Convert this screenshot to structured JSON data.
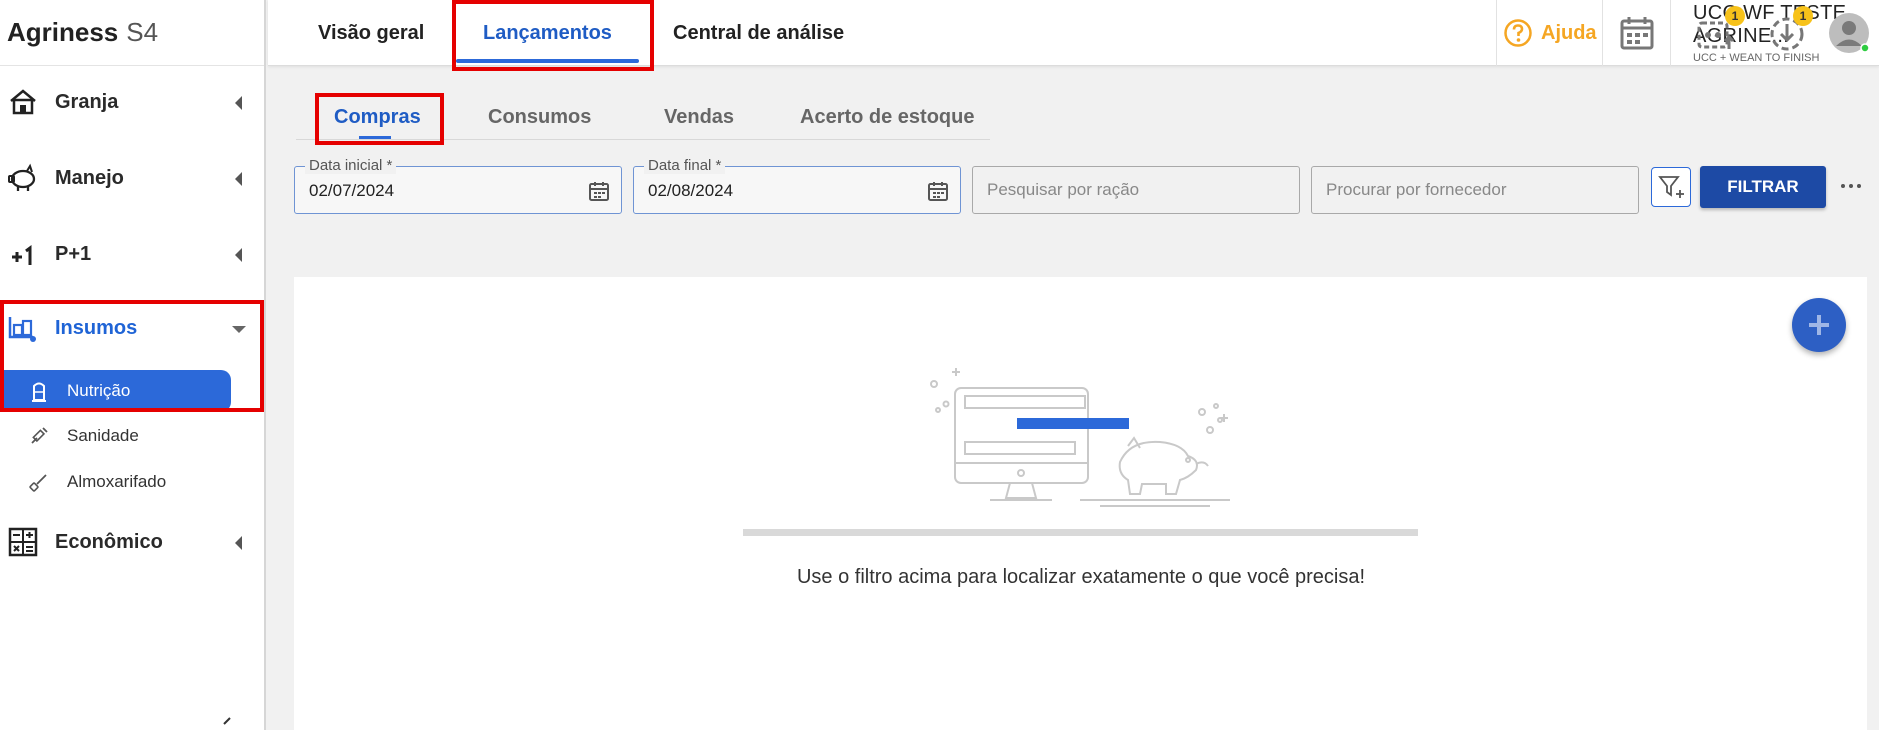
{
  "brand": {
    "name": "Agriness",
    "version": "S4"
  },
  "sidebar": {
    "items": [
      {
        "label": "Granja",
        "icon": "house-icon"
      },
      {
        "label": "Manejo",
        "icon": "pig-icon"
      },
      {
        "label": "P+1",
        "icon": "plus-one-icon"
      },
      {
        "label": "Insumos",
        "icon": "supplies-cart-icon",
        "expanded": true
      },
      {
        "label": "Econômico",
        "icon": "calculator-icon"
      }
    ],
    "subitems": [
      {
        "label": "Nutrição",
        "icon": "silo-icon",
        "active": true
      },
      {
        "label": "Sanidade",
        "icon": "syringe-icon"
      },
      {
        "label": "Almoxarifado",
        "icon": "shovel-icon"
      }
    ]
  },
  "topbar": {
    "tabs": [
      {
        "label": "Visão geral"
      },
      {
        "label": "Lançamentos",
        "active": true
      },
      {
        "label": "Central de análise"
      }
    ],
    "help_label": "Ajuda",
    "farm_name": "UCC WF TESTE AGRINE...",
    "farm_sub": "UCC + WEAN TO FINISH",
    "badge_1": "1",
    "badge_2": "1"
  },
  "subtabs": [
    {
      "label": "Compras",
      "active": true
    },
    {
      "label": "Consumos"
    },
    {
      "label": "Vendas"
    },
    {
      "label": "Acerto de estoque"
    }
  ],
  "filters": {
    "start_date_label": "Data inicial *",
    "start_date_value": "02/07/2024",
    "end_date_label": "Data final *",
    "end_date_value": "02/08/2024",
    "ration_placeholder": "Pesquisar por ração",
    "supplier_placeholder": "Procurar por fornecedor",
    "filter_button": "FILTRAR"
  },
  "empty_state": {
    "message": "Use o filtro acima para localizar exatamente o que você precisa!"
  },
  "colors": {
    "accent": "#2c69d9",
    "primary_dark": "#1d4aa5",
    "help": "#f5a623",
    "highlight_box": "#e50000",
    "badge": "#f7c21a"
  }
}
